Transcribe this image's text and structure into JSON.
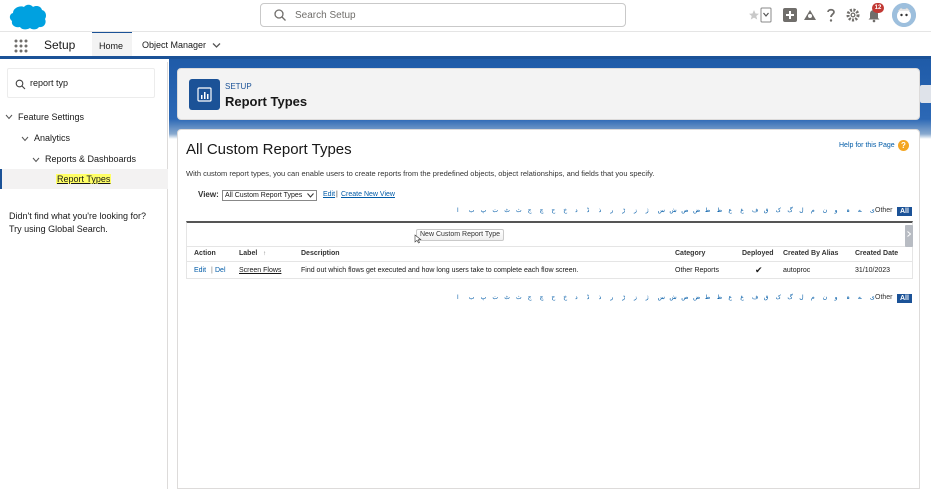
{
  "header": {
    "search_placeholder": "Search Setup",
    "notifications_count": "12"
  },
  "context": {
    "app_name": "Setup",
    "tabs": [
      {
        "label": "Home"
      },
      {
        "label": "Object Manager"
      }
    ]
  },
  "sidebar": {
    "quick_find_value": "report typ",
    "tree": {
      "level1": "Feature Settings",
      "level2": "Analytics",
      "level3": "Reports & Dashboards",
      "leaf": "Report Types"
    },
    "not_found_line1": "Didn't find what you're looking for?",
    "not_found_line2": "Try using Global Search."
  },
  "page_header": {
    "eyebrow": "SETUP",
    "title": "Report Types"
  },
  "main": {
    "title": "All Custom Report Types",
    "help_link": "Help for this Page",
    "help_icon": "?",
    "intro": "With custom report types, you can enable users to create reports from the predefined objects, object relationships, and fields that you specify.",
    "view_label": "View:",
    "view_selected": "All Custom Report Types",
    "view_edit": "Edit",
    "view_sep": "|",
    "view_create": "Create New View",
    "alphabet": [
      "ی",
      "ے",
      "ہ",
      "و",
      "ن",
      "م",
      "ل",
      "گ",
      "ک",
      "ق",
      "ف",
      "غ",
      "ع",
      "ظ",
      "ط",
      "ض",
      "ص",
      "ش",
      "س",
      "ژ",
      "ز",
      "ڑ",
      "ر",
      "ذ",
      "ڈ",
      "د",
      "خ",
      "ح",
      "چ",
      "ج",
      "ث",
      "ٹ",
      "ت",
      "پ",
      "ب",
      "ا"
    ],
    "alpha_other": "Other",
    "alpha_all": "All",
    "new_button": "New Custom Report Type",
    "columns": {
      "action": "Action",
      "label": "Label",
      "label_sort": "↑",
      "description": "Description",
      "category": "Category",
      "deployed": "Deployed",
      "created_by": "Created By Alias",
      "created_date": "Created Date"
    },
    "rows": [
      {
        "edit": "Edit",
        "sep": "|",
        "del": "Del",
        "label": "Screen Flows",
        "description": "Find out which flows get executed and how long users take to complete each flow screen.",
        "category": "Other Reports",
        "deployed": "✔",
        "created_by": "autoproc",
        "created_date": "31/10/2023"
      }
    ]
  },
  "colors": {
    "brand_blue": "#1b5297",
    "link_blue": "#015ba7",
    "salesforce_cloud": "#00a1e0",
    "help_orange": "#f4a623"
  }
}
